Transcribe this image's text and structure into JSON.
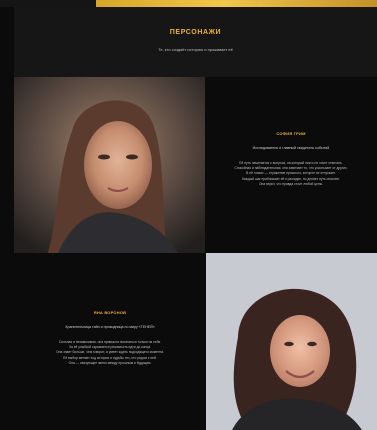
{
  "hero": {
    "title": "ПЕРСОНАЖИ",
    "subtitle": "Те, кто создаёт историю и проживает её"
  },
  "cards": [
    {
      "name": "СОФИЯ ГРИМ",
      "role": "Исследователь и главный свидетель событий",
      "body": "Её путь начинается с вопроса, на который никто не хочет отвечать.\nСпокойная и наблюдательная, она замечает то, что ускользает от других.\nВ её глазах — отражение прошлого, которое не отпускает.\nКаждый шаг приближает её к разгадке, но делает путь опаснее.\nОна верит, что правда стоит любой цены."
    },
    {
      "name": "ЯНА ВОРОНОВ",
      "role": "Хранительница тайн и проводница по миру «ТЕНЕЙ»",
      "body": "Сильная и независимая, она привыкла полагаться только на себя.\nЗа её улыбкой скрывается решимость идти до конца.\nОна знает больше, чем говорит, и умеет ждать подходящего момента.\nЕё выбор меняет ход истории и судьбы тех, кто рядом с ней.\nОна — связующее звено между прошлым и будущим."
    }
  ],
  "colors": {
    "accent": "#f0b130",
    "background": "#0b0b0b",
    "hero_background": "#161616"
  }
}
